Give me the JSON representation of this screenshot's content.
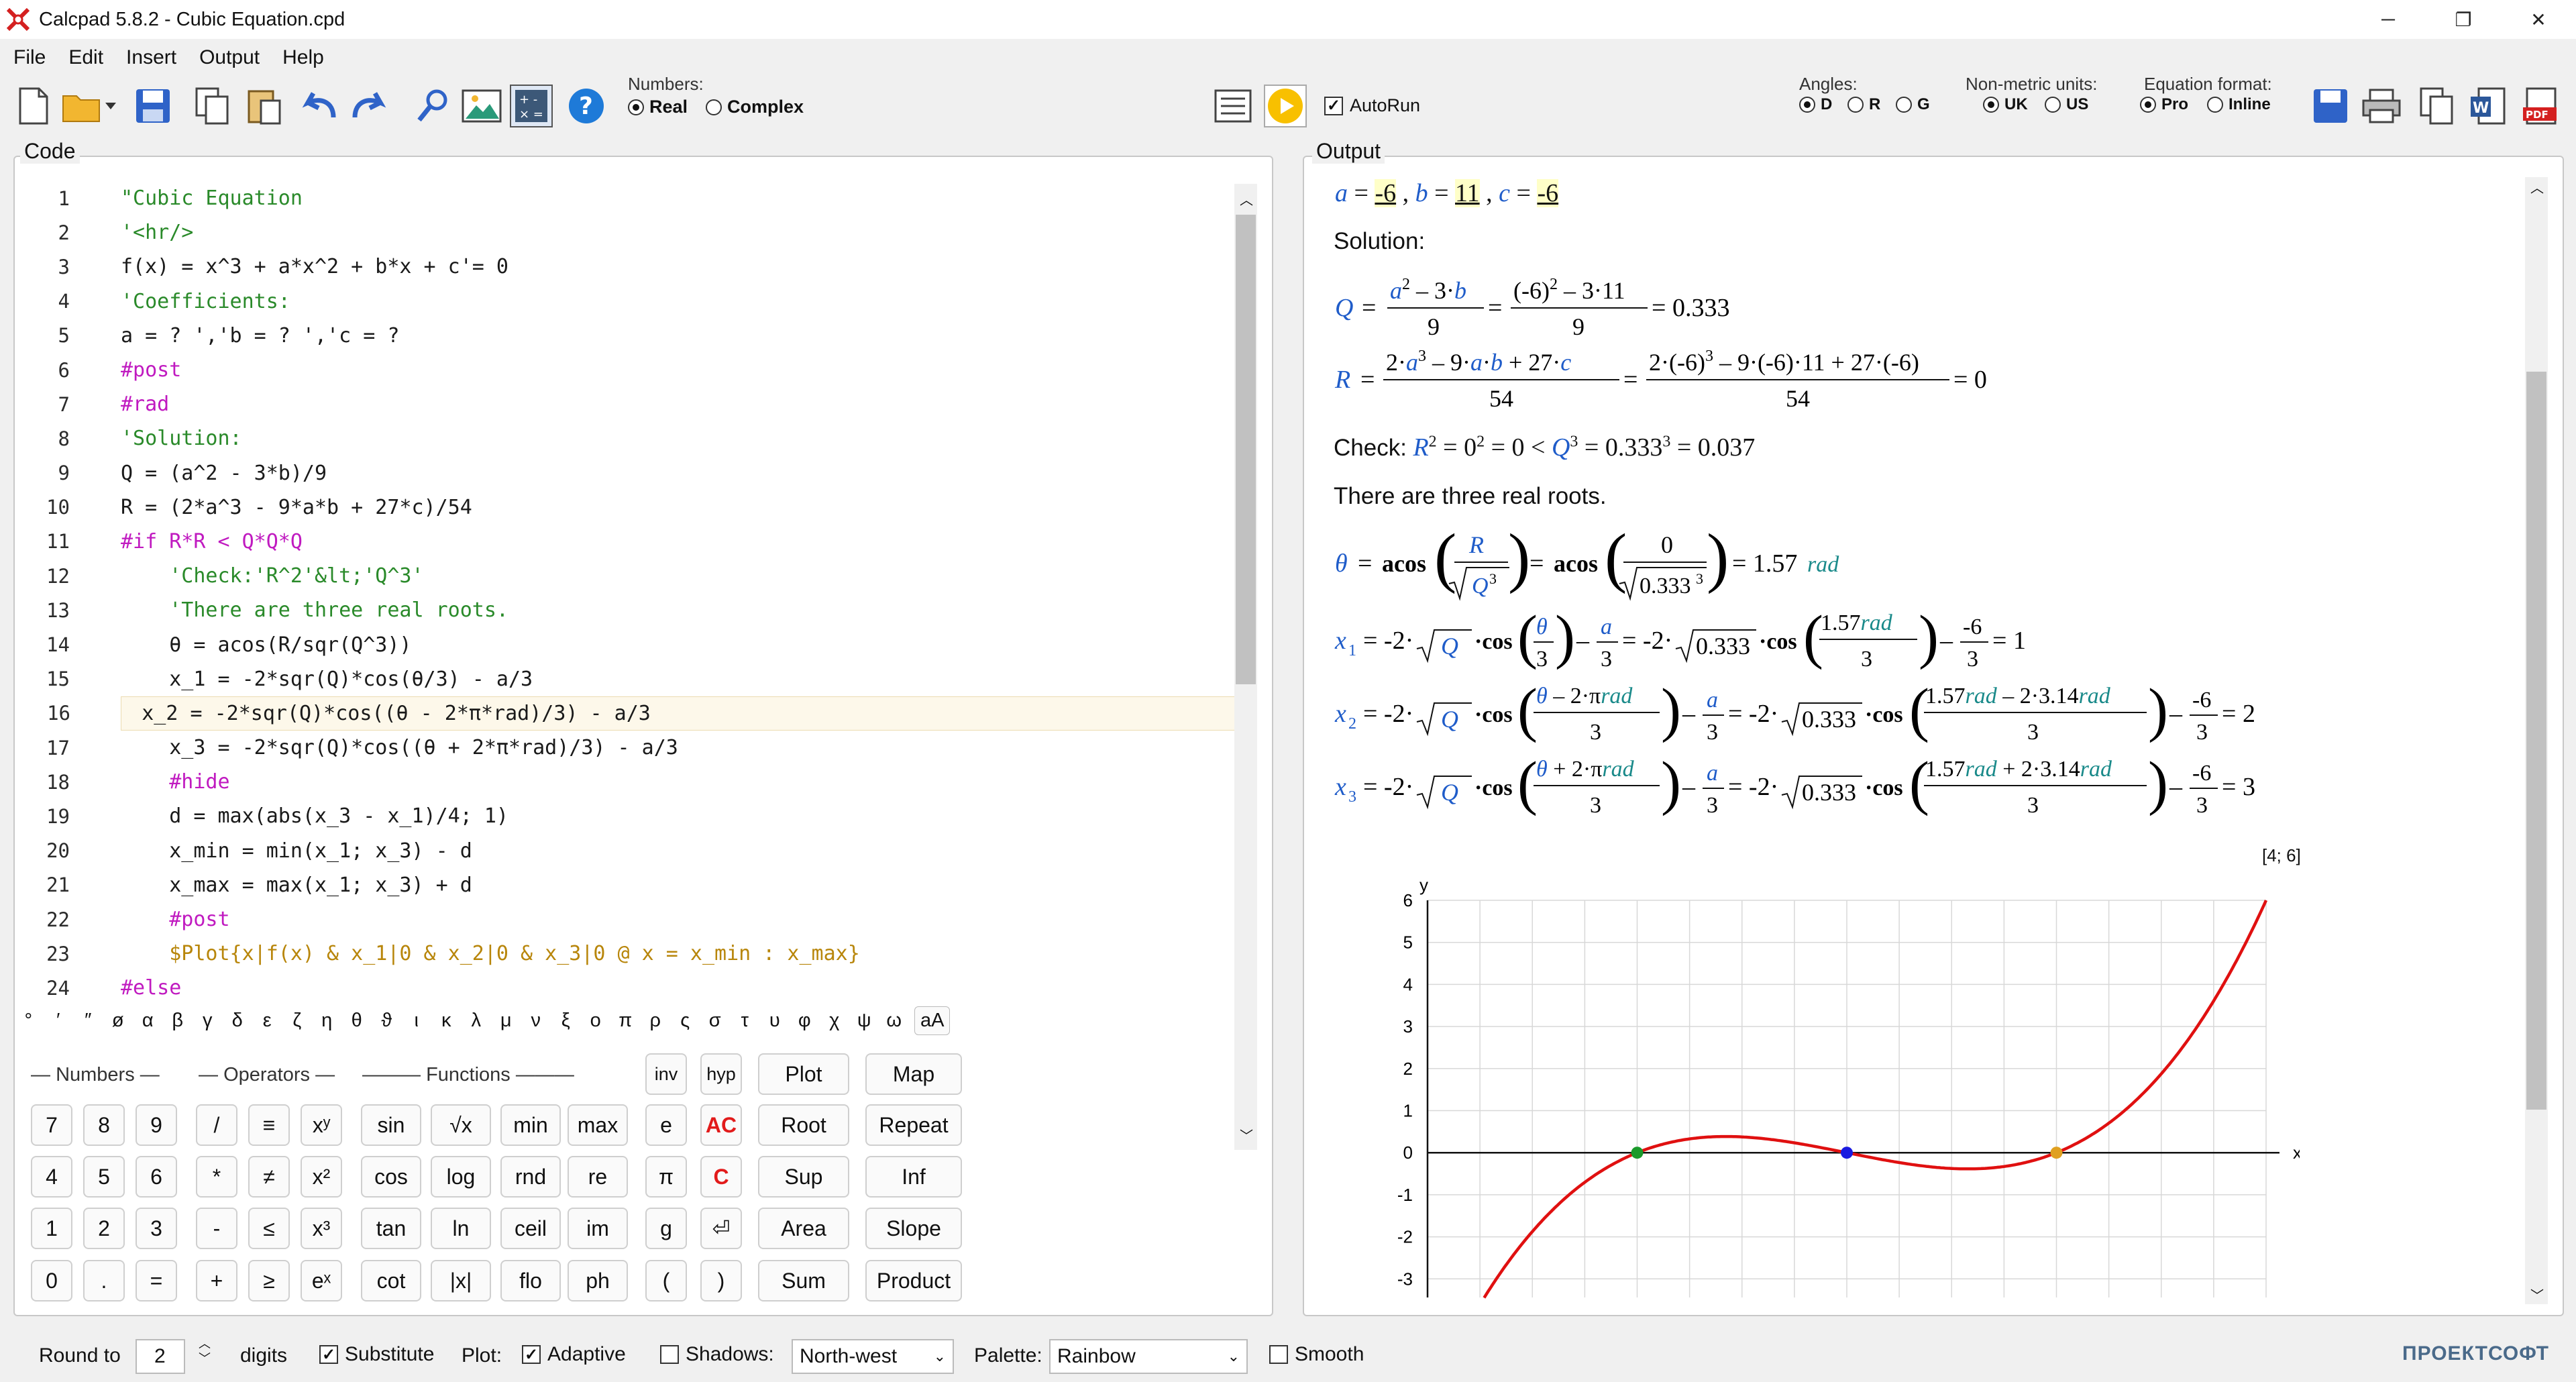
{
  "window": {
    "title": "Calcpad 5.8.2 - Cubic Equation.cpd"
  },
  "menu": [
    "File",
    "Edit",
    "Insert",
    "Output",
    "Help"
  ],
  "toolbar": {
    "numbers_label": "Numbers:",
    "real": "Real",
    "complex": "Complex",
    "autorun": "AutoRun",
    "angles_label": "Angles:",
    "angles": [
      "D",
      "R",
      "G"
    ],
    "units_label": "Non-metric units:",
    "units": [
      "UK",
      "US"
    ],
    "eqformat_label": "Equation format:",
    "eqformat": [
      "Pro",
      "Inline"
    ]
  },
  "code_panel": {
    "title": "Code",
    "lines": [
      "\"Cubic Equation",
      "'<hr/>",
      "f(x) = x^3 + a*x^2 + b*x + c'= 0",
      "'Coefficients:",
      "a = ? ','b = ? ','c = ?",
      "#post",
      "#rad",
      "'Solution:",
      "Q = (a^2 - 3*b)/9",
      "R = (2*a^3 - 9*a*b + 27*c)/54",
      "#if R*R < Q*Q*Q",
      "    'Check:'R^2'&lt;'Q^3'",
      "    'There are three real roots.",
      "    θ = acos(R/sqr(Q^3))",
      "    x_1 = -2*sqr(Q)*cos(θ/3) - a/3",
      "    x_2 = -2*sqr(Q)*cos((θ - 2*π*rad)/3) - a/3",
      "    x_3 = -2*sqr(Q)*cos((θ + 2*π*rad)/3) - a/3",
      "    #hide",
      "    d = max(abs(x_3 - x_1)/4; 1)",
      "    x_min = min(x_1; x_3) - d",
      "    x_max = max(x_1; x_3) + d",
      "    #post",
      "    $Plot{x|f(x) & x_1|0 & x_2|0 & x_3|0 @ x = x_min : x_max}",
      "#else"
    ]
  },
  "greek": [
    "°",
    "′",
    "″",
    "ø",
    "α",
    "β",
    "γ",
    "δ",
    "ε",
    "ζ",
    "η",
    "θ",
    "ϑ",
    "ι",
    "κ",
    "λ",
    "μ",
    "ν",
    "ξ",
    "ο",
    "π",
    "ρ",
    "ς",
    "σ",
    "τ",
    "υ",
    "φ",
    "χ",
    "ψ",
    "ω",
    "aA"
  ],
  "keypad": {
    "numbers_label": "Numbers",
    "operators_label": "Operators",
    "functions_label": "Functions",
    "numbers": [
      "7",
      "8",
      "9",
      "4",
      "5",
      "6",
      "1",
      "2",
      "3",
      "0",
      ".",
      "="
    ],
    "operators": [
      "/",
      "≡",
      "xʸ",
      "*",
      "≠",
      "x²",
      "-",
      "≤",
      "x³",
      "+",
      "≥",
      "eˣ"
    ],
    "functions": [
      "sin",
      "√x",
      "min",
      "max",
      "cos",
      "log",
      "rnd",
      "re",
      "tan",
      "ln",
      "ceil",
      "im",
      "cot",
      "|x|",
      "flo",
      "ph"
    ],
    "misc": [
      "inv",
      "hyp",
      "e",
      "AC",
      "π",
      "C",
      "g",
      "⏎",
      "(",
      ")"
    ],
    "commands": [
      "Plot",
      "Map",
      "Root",
      "Repeat",
      "Sup",
      "Inf",
      "Area",
      "Slope",
      "Sum",
      "Product"
    ]
  },
  "output_panel": {
    "title": "Output",
    "inputs": {
      "a": "-6",
      "b": "11",
      "c": "-6"
    },
    "solution_label": "Solution:",
    "Q_result": "0.333",
    "R_result": "0",
    "check_label": "Check:",
    "check_text": "= 0² = 0 < ",
    "check_result": "= 0.333³ = 0.037",
    "roots_text": "There are three real roots.",
    "theta_result": "1.57",
    "x1_result": "1",
    "x2_result": "2",
    "x3_result": "3",
    "plot_range": "[4; 6]"
  },
  "chart_data": {
    "type": "line",
    "xlabel": "x",
    "ylabel": "y",
    "xlim": [
      0,
      4
    ],
    "ylim": [
      -3.5,
      6
    ],
    "yticks": [
      6,
      5,
      4,
      3,
      2,
      1,
      0,
      -1,
      -2,
      -3
    ],
    "series": [
      {
        "points": [
          [
            0.4,
            -3.5
          ],
          [
            0.7,
            -1.8
          ],
          [
            1.0,
            0
          ],
          [
            1.3,
            0.3
          ],
          [
            1.5,
            0.375
          ],
          [
            1.8,
            0.192
          ],
          [
            2.0,
            0
          ],
          [
            2.2,
            -0.168
          ],
          [
            2.5,
            -0.375
          ],
          [
            2.8,
            -0.288
          ],
          [
            3.0,
            0
          ],
          [
            3.3,
            0.627
          ],
          [
            3.6,
            1.716
          ],
          [
            4.0,
            6
          ]
        ]
      }
    ],
    "markers": [
      {
        "x": 1,
        "y": 0,
        "color": "#1a9a2a"
      },
      {
        "x": 2,
        "y": 0,
        "color": "#1a1ae0"
      },
      {
        "x": 3,
        "y": 0,
        "color": "#e0a020"
      }
    ],
    "colors": {
      "curve": "#e01010",
      "grid": "#d8d8d8"
    }
  },
  "status": {
    "round_label": "Round to",
    "round_value": "2",
    "digits": "digits",
    "substitute": "Substitute",
    "plot_label": "Plot:",
    "adaptive": "Adaptive",
    "shadows_label": "Shadows:",
    "shadows_value": "North-west",
    "palette_label": "Palette:",
    "palette_value": "Rainbow",
    "smooth": "Smooth",
    "brand": "ПРОЕКТСОФТ"
  }
}
